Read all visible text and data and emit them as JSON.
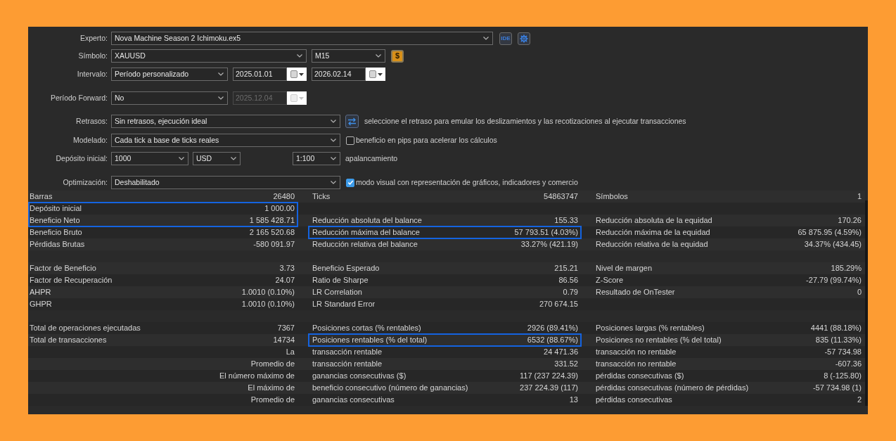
{
  "settings": [
    {
      "label": "Experto:",
      "controls": [
        {
          "kind": "select",
          "value": "Nova Machine Season 2 Ichimoku.ex5",
          "disabled": false
        },
        {
          "kind": "outlined",
          "text": "IDE"
        },
        {
          "kind": "gear"
        }
      ]
    },
    {
      "label": "Símbolo:",
      "controls": [
        {
          "kind": "select",
          "value": "XAUUSD",
          "disabled": false
        },
        {
          "kind": "select",
          "value": "M15",
          "disabled": false
        },
        {
          "kind": "filled",
          "text": "$"
        }
      ]
    },
    {
      "label": "Intervalo:",
      "controls": [
        {
          "kind": "select",
          "value": "Período personalizado",
          "disabled": false
        },
        {
          "kind": "date",
          "value": "2025.01.01",
          "disabled": false
        },
        {
          "kind": "date",
          "value": "2026.02.14",
          "disabled": false
        }
      ]
    },
    {
      "label": "Período Forward:",
      "controls": [
        {
          "kind": "select",
          "value": "No",
          "disabled": false
        },
        {
          "kind": "date",
          "value": "2025.12.04",
          "disabled": true
        }
      ]
    },
    {
      "label": "Retrasos:",
      "controls": [
        {
          "kind": "select",
          "value": "Sin retrasos, ejecución ideal",
          "disabled": false
        },
        {
          "kind": "swap"
        },
        {
          "kind": "text",
          "text": "seleccione el retraso para emular los deslizamientos y las recotizaciones al ejecutar transacciones"
        }
      ]
    },
    {
      "label": "Modelado:",
      "controls": [
        {
          "kind": "select",
          "value": "Cada tick a base de ticks reales",
          "disabled": false
        },
        {
          "kind": "checkbox",
          "checked": false,
          "text": "beneficio en pips para acelerar los cálculos"
        }
      ]
    },
    {
      "label": "Depósito inicial:",
      "controls": [
        {
          "kind": "select",
          "value": "1000",
          "disabled": false
        },
        {
          "kind": "select",
          "value": "USD",
          "disabled": false
        },
        {
          "kind": "select",
          "value": "1:100",
          "disabled": false
        },
        {
          "kind": "text",
          "text": "apalancamiento"
        }
      ]
    },
    {
      "label": "Optimización:",
      "controls": [
        {
          "kind": "select",
          "value": "Deshabilitado",
          "disabled": false
        },
        {
          "kind": "checkbox",
          "checked": true,
          "text": "modo visual con representación de gráficos, indicadores y comercio"
        }
      ]
    }
  ],
  "stats": {
    "rows": [
      [
        {
          "label": "Barras",
          "value": "26480",
          "highlighted": false
        },
        {
          "label": "Ticks",
          "value": "54863747",
          "highlighted": false
        },
        {
          "label": "Símbolos",
          "value": "1",
          "highlighted": false
        }
      ],
      [
        {
          "label": "Depósito inicial",
          "value": "1 000.00",
          "highlighted": true
        },
        null,
        null
      ],
      [
        {
          "label": "Beneficio Neto",
          "value": "1 585 428.71",
          "highlighted": true
        },
        {
          "label": "Reducción absoluta del balance",
          "value": "155.33",
          "highlighted": false
        },
        {
          "label": "Reducción absoluta de la equidad",
          "value": "170.26",
          "highlighted": false
        }
      ],
      [
        {
          "label": "Beneficio Bruto",
          "value": "2 165 520.68",
          "highlighted": false
        },
        {
          "label": "Reducción máxima del balance",
          "value": "57 793.51 (4.03%)",
          "highlighted": true
        },
        {
          "label": "Reducción máxima de la equidad",
          "value": "65 875.95 (4.59%)",
          "highlighted": false
        }
      ],
      [
        {
          "label": "Pérdidas Brutas",
          "value": "-580 091.97",
          "highlighted": false
        },
        {
          "label": "Reducción relativa del balance",
          "value": "33.27% (421.19)",
          "highlighted": false
        },
        {
          "label": "Reducción relativa de la equidad",
          "value": "34.37% (434.45)",
          "highlighted": false
        }
      ],
      [
        null,
        null,
        null
      ],
      [
        {
          "label": "Factor de Beneficio",
          "value": "3.73",
          "highlighted": false
        },
        {
          "label": "Beneficio Esperado",
          "value": "215.21",
          "highlighted": false
        },
        {
          "label": "Nivel de margen",
          "value": "185.29%",
          "highlighted": false
        }
      ],
      [
        {
          "label": "Factor de Recuperación",
          "value": "24.07",
          "highlighted": false
        },
        {
          "label": "Ratio de Sharpe",
          "value": "86.56",
          "highlighted": false
        },
        {
          "label": "Z-Score",
          "value": "-27.79 (99.74%)",
          "highlighted": false
        }
      ],
      [
        {
          "label": "AHPR",
          "value": "1.0010 (0.10%)",
          "highlighted": false
        },
        {
          "label": "LR Correlation",
          "value": "0.79",
          "highlighted": false
        },
        {
          "label": "Resultado de OnTester",
          "value": "0",
          "highlighted": false
        }
      ],
      [
        {
          "label": "GHPR",
          "value": "1.0010 (0.10%)",
          "highlighted": false
        },
        {
          "label": "LR Standard Error",
          "value": "270 674.15",
          "highlighted": false
        },
        null
      ],
      [
        null,
        null,
        null
      ],
      [
        {
          "label": "Total de operaciones ejecutadas",
          "value": "7367",
          "highlighted": false
        },
        {
          "label": "Posiciones cortas (% rentables)",
          "value": "2926 (89.41%)",
          "highlighted": false
        },
        {
          "label": "Posiciones largas (% rentables)",
          "value": "4441 (88.18%)",
          "highlighted": false
        }
      ],
      [
        {
          "label": "Total de transacciones",
          "value": "14734",
          "highlighted": false
        },
        {
          "label": "Posiciones rentables (% del total)",
          "value": "6532 (88.67%)",
          "highlighted": true
        },
        {
          "label": "Posiciones no rentables (% del total)",
          "value": "835 (11.33%)",
          "highlighted": false
        }
      ],
      [
        {
          "value": "La",
          "highlighted": false
        },
        {
          "label": "transacción rentable",
          "value": "24 471.36",
          "highlighted": false
        },
        {
          "label": "transacción no rentable",
          "value": "-57 734.98",
          "highlighted": false
        }
      ],
      [
        {
          "value": "Promedio de",
          "highlighted": false
        },
        {
          "label": "transacción rentable",
          "value": "331.52",
          "highlighted": false
        },
        {
          "label": "transacción no rentable",
          "value": "-607.36",
          "highlighted": false
        }
      ],
      [
        {
          "value": "El número máximo de",
          "highlighted": false
        },
        {
          "label": "ganancias consecutivas ($)",
          "value": "117 (237 224.39)",
          "highlighted": false
        },
        {
          "label": "pérdidas consecutivas ($)",
          "value": "8 (-125.80)",
          "highlighted": false
        }
      ],
      [
        {
          "value": "El máximo de",
          "highlighted": false
        },
        {
          "label": "beneficio consecutivo (número de ganancias)",
          "value": "237 224.39 (117)",
          "highlighted": false
        },
        {
          "label": "pérdidas consecutivas (número de pérdidas)",
          "value": "-57 734.98 (1)",
          "highlighted": false
        }
      ],
      [
        {
          "value": "Promedio de",
          "highlighted": false
        },
        {
          "label": "ganancias consecutivas",
          "value": "13",
          "highlighted": false
        },
        {
          "label": "pérdidas consecutivas",
          "value": "2",
          "highlighted": false
        }
      ]
    ]
  }
}
